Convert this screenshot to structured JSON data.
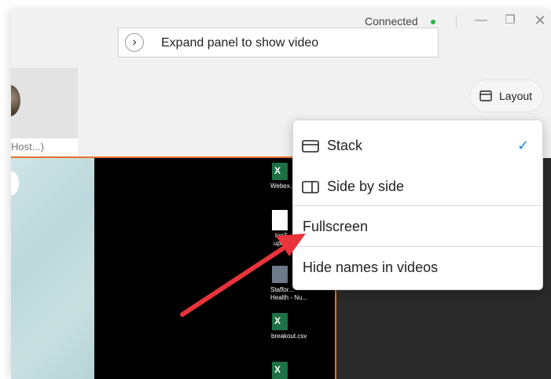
{
  "titlebar": {
    "status_text": "Connected",
    "status_color": "#2cb34a",
    "minimize_glyph": "—",
    "maximize_glyph": "❐",
    "close_glyph": "✕"
  },
  "expand_panel": {
    "icon": "chevron-right-icon",
    "label": "Expand panel to show video"
  },
  "participant": {
    "name": "Host...)"
  },
  "layout_button": {
    "icon": "layout-icon",
    "label": "Layout"
  },
  "desktop_share": {
    "icons": [
      {
        "label": "Webex..."
      },
      {
        "label": "log3"
      },
      {
        "label": "upd..."
      },
      {
        "label": "Staffor..."
      },
      {
        "label": "Health - Nu..."
      },
      {
        "label": "breakout.csv"
      }
    ]
  },
  "layout_menu": {
    "items": [
      {
        "label": "Stack",
        "icon": "stack-layout-icon",
        "checked": true
      },
      {
        "label": "Side by side",
        "icon": "side-by-side-icon",
        "checked": false
      },
      {
        "label": "Fullscreen",
        "checked": false
      },
      {
        "label": "Hide names in videos",
        "checked": false
      }
    ],
    "check_glyph": "✓"
  },
  "colors": {
    "accent": "#1f8ad9",
    "active_border": "#e8742a",
    "annotation_arrow": "#e8343a"
  }
}
